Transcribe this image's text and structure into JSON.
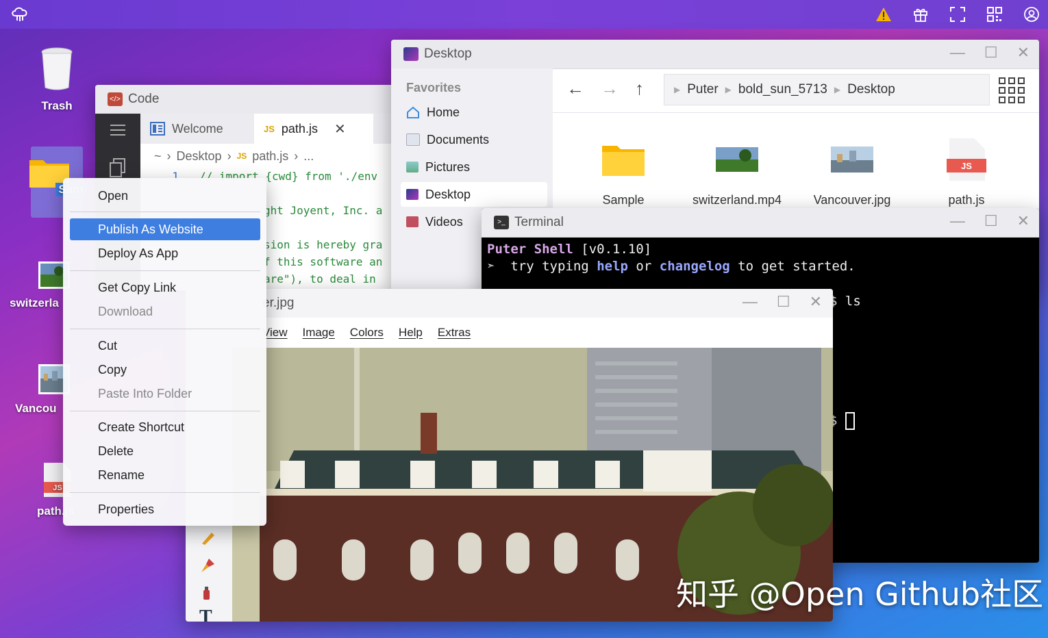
{
  "topbar": {
    "icons": [
      "puter-logo-icon",
      "warning-icon",
      "gift-icon",
      "fullscreen-icon",
      "qr-code-icon",
      "user-icon"
    ]
  },
  "desktop": {
    "items": [
      {
        "label": "Trash"
      },
      {
        "label": "Sam"
      },
      {
        "label": "switzerla"
      },
      {
        "label": "Vancou"
      },
      {
        "label": "path.js"
      }
    ]
  },
  "code_window": {
    "title": "Code",
    "tabs": [
      {
        "label": "Welcome"
      },
      {
        "label": "path.js"
      }
    ],
    "breadcrumb": {
      "home": "~",
      "folder": "Desktop",
      "file": "path.js",
      "more": "..."
    },
    "lines": [
      {
        "num": "1",
        "text": "// import {cwd} from './env"
      },
      {
        "num": "",
        "text": "ght Joyent, Inc. a"
      },
      {
        "num": "",
        "text": "sion is hereby gra"
      },
      {
        "num": "",
        "text": "f this software an"
      },
      {
        "num": "",
        "text": "are\"), to deal in "
      }
    ]
  },
  "files_window": {
    "title": "Desktop",
    "sidebar_heading": "Favorites",
    "sidebar_items": [
      {
        "label": "Home"
      },
      {
        "label": "Documents"
      },
      {
        "label": "Pictures"
      },
      {
        "label": "Desktop"
      },
      {
        "label": "Videos"
      }
    ],
    "path": [
      "Puter",
      "bold_sun_5713",
      "Desktop"
    ],
    "files": [
      {
        "name": "Sample"
      },
      {
        "name": "switzerland.mp4"
      },
      {
        "name": "Vancouver.jpg"
      },
      {
        "name": "path.js"
      }
    ]
  },
  "terminal_window": {
    "title": "Terminal",
    "shell_name": "Puter Shell",
    "version": "[v0.1.10]",
    "hint_prefix": "try typing",
    "hint_cmd1": "help",
    "hint_mid": "or",
    "hint_cmd2": "changelog",
    "hint_suffix": "to get started.",
    "prompt_fragment": "$ ls",
    "cursor_fragment": "$"
  },
  "image_window": {
    "title": "er.jpg",
    "menu": [
      "View",
      "Image",
      "Colors",
      "Help",
      "Extras"
    ]
  },
  "context_menu": {
    "items": [
      {
        "label": "Open"
      },
      {
        "label": "Publish As Website"
      },
      {
        "label": "Deploy As App"
      },
      {
        "label": "Get Copy Link"
      },
      {
        "label": "Download"
      },
      {
        "label": "Cut"
      },
      {
        "label": "Copy"
      },
      {
        "label": "Paste Into Folder"
      },
      {
        "label": "Create Shortcut"
      },
      {
        "label": "Delete"
      },
      {
        "label": "Rename"
      },
      {
        "label": "Properties"
      }
    ]
  },
  "watermark": "知乎 @Open Github社区",
  "colors": {
    "accent": "#3e7ee0",
    "terminal_bg": "#000000",
    "shell_name": "#d7a8e8",
    "keyword": "#9aa8ff"
  }
}
